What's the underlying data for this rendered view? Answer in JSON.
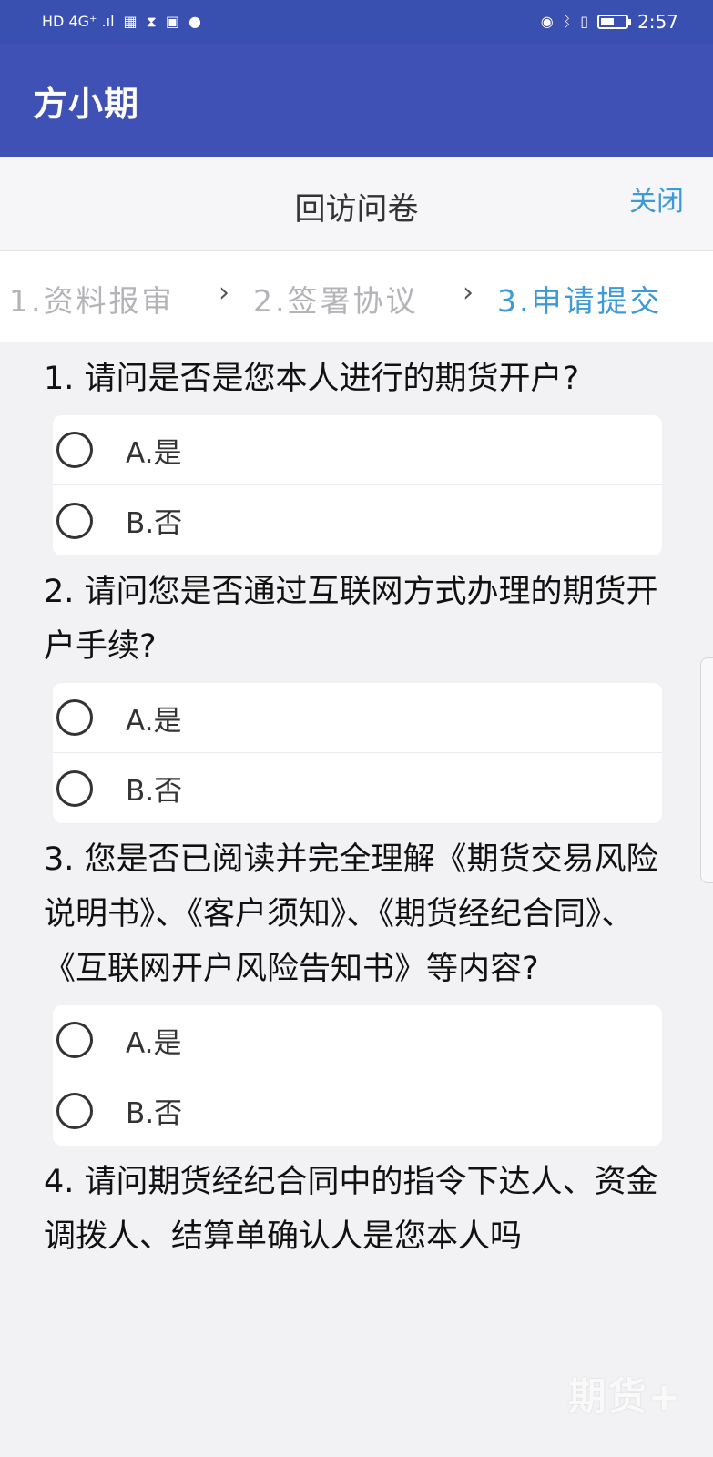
{
  "status_bar": {
    "network": "HD 4G⁺ .ıl",
    "time": "2:57"
  },
  "app": {
    "title": "方小期"
  },
  "dialog": {
    "title": "回访问卷",
    "close_label": "关闭"
  },
  "steps": [
    {
      "label": "1.资料报审"
    },
    {
      "label": "2.签署协议"
    },
    {
      "label": "3.申请提交"
    }
  ],
  "questions": [
    {
      "text": "1. 请问是否是您本人进行的期货开户?",
      "options": [
        {
          "label": "A.是"
        },
        {
          "label": "B.否"
        }
      ]
    },
    {
      "text": "2. 请问您是否通过互联网方式办理的期货开户手续?",
      "options": [
        {
          "label": "A.是"
        },
        {
          "label": "B.否"
        }
      ]
    },
    {
      "text": "3. 您是否已阅读并完全理解《期货交易风险说明书》、《客户须知》、《期货经纪合同》、《互联网开户风险告知书》等内容?",
      "options": [
        {
          "label": "A.是"
        },
        {
          "label": "B.否"
        }
      ]
    },
    {
      "text": "4. 请问期货经纪合同中的指令下达人、资金调拨人、结算单确认人是您本人吗"
    }
  ],
  "watermark": "期货+",
  "colors": {
    "status_bar": "#3a50b0",
    "app_bar": "#3f51b5",
    "accent": "#3d9ad8"
  }
}
